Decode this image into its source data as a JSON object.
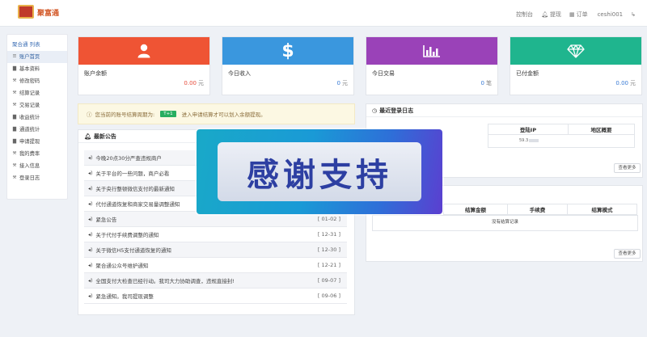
{
  "header": {
    "brand": "聚富通",
    "nav": [
      {
        "label": "控制台",
        "icon": "dashboard-icon"
      },
      {
        "label": "提现",
        "icon": "bell-icon"
      },
      {
        "label": "订单",
        "icon": "calendar-icon"
      },
      {
        "label": "ceshi001",
        "icon": "user-icon"
      }
    ]
  },
  "sidebar": {
    "title": "聚合通 列表",
    "items": [
      {
        "label": "账户首页",
        "active": true
      },
      {
        "label": "基本资料"
      },
      {
        "label": "修改密码"
      },
      {
        "label": "结算记录"
      },
      {
        "label": "交易记录"
      },
      {
        "label": "收益统计"
      },
      {
        "label": "通道统计"
      },
      {
        "label": "申请提现"
      },
      {
        "label": "我的费率"
      },
      {
        "label": "接入信息"
      },
      {
        "label": "登录日志"
      }
    ]
  },
  "cards": [
    {
      "label": "账户余额",
      "value": "0.00",
      "unit": "元",
      "color": "#e74c3c",
      "value_color": "#e74c3c",
      "icon": "user-icon"
    },
    {
      "label": "今日收入",
      "value": "0",
      "unit": "元",
      "color": "#3498db",
      "value_color": "#3a7bd5",
      "icon": "dollar-icon"
    },
    {
      "label": "今日交易",
      "value": "0",
      "unit": "笔",
      "color": "#8e44ad",
      "value_color": "#3a7bd5",
      "icon": "bar-chart-icon"
    },
    {
      "label": "已付金额",
      "value": "0.00",
      "unit": "元",
      "color": "#1abc9c",
      "value_color": "#3a7bd5",
      "icon": "diamond-icon"
    }
  ],
  "notice": {
    "prefix": "您当前的账号结算周期为:",
    "badge": "T+1",
    "suffix": "进入申请结算才可以划入余额提现。"
  },
  "announcements": {
    "title": "最新公告",
    "items": [
      {
        "text": "今晚20点30分严查违规商户",
        "date": ""
      },
      {
        "text": "关于平台的一些问题，商户必看",
        "date": ""
      },
      {
        "text": "关于央行整顿微信支付的最新通知",
        "date": ""
      },
      {
        "text": "代付通道恢复和商家交易量调整通知",
        "date": ""
      },
      {
        "text": "紧急公告",
        "date": "[ 01-02 ]"
      },
      {
        "text": "关于代付手续费调整的通知",
        "date": "[ 12-31 ]"
      },
      {
        "text": "关于微信H5支付通道恢复的通知",
        "date": "[ 12-30 ]"
      },
      {
        "text": "聚合通公众号维护通知",
        "date": "[ 12-21 ]"
      },
      {
        "text": "全国支付大检查已经行动。我司大力协助调查，违规直接封!",
        "date": "[ 09-07 ]"
      },
      {
        "text": "紧急通知。我司提现调整",
        "date": "[ 09-06 ]"
      }
    ]
  },
  "login_log": {
    "title": "最近登录日志",
    "columns": [
      "登陆IP",
      "地区概要"
    ],
    "row_ip": "59.3",
    "more": "查看更多"
  },
  "settle_log": {
    "columns": [
      "结算金额",
      "手续费",
      "结算模式"
    ],
    "empty": "没有结算记录",
    "more": "查看更多"
  },
  "overlay": {
    "text": "感谢支持"
  }
}
